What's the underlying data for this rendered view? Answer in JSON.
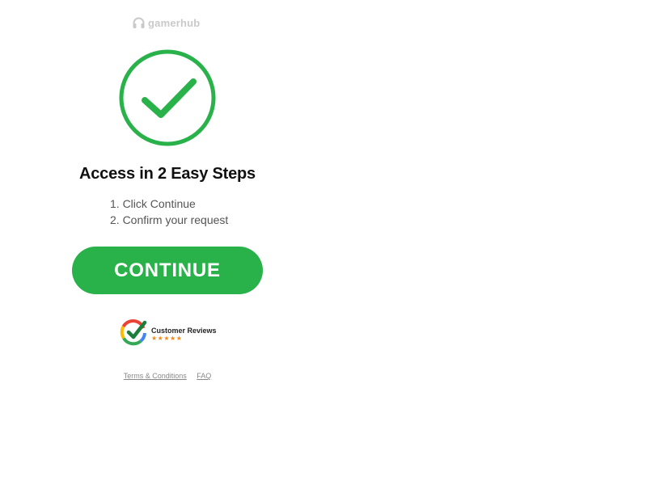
{
  "brand": {
    "logo_text": "gamerhub",
    "logo_icon": "headset-icon",
    "logo_color": "#c9c9c9"
  },
  "hero": {
    "icon": "check-circle-icon",
    "accent_color": "#29b14a"
  },
  "heading": "Access in 2 Easy Steps",
  "steps": [
    "1. Click Continue",
    "2. Confirm your request"
  ],
  "cta": {
    "label": "CONTINUE",
    "color": "#29b14a"
  },
  "reviews": {
    "icon": "google-check-icon",
    "label": "Customer Reviews",
    "stars": "★★★★★",
    "star_color": "#f08a1c"
  },
  "footer": {
    "links": [
      "Terms & Conditions",
      "FAQ"
    ]
  }
}
